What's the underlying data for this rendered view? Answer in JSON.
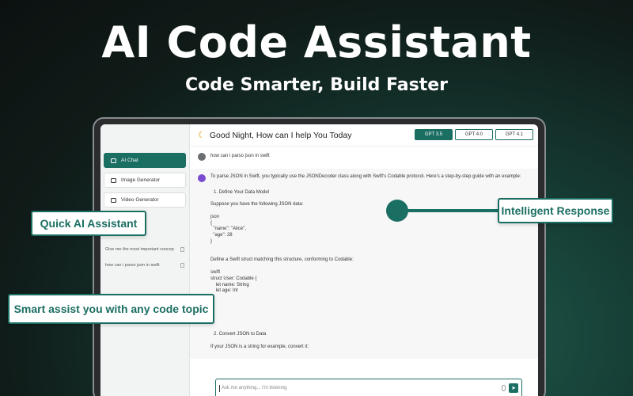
{
  "hero": {
    "title": "AI Code Assistant",
    "subtitle": "Code Smarter, Build Faster"
  },
  "sidebar": {
    "items": [
      {
        "label": "AI Chat",
        "icon": "chat-icon",
        "active": true
      },
      {
        "label": "Image Generator",
        "icon": "image-icon",
        "active": false
      },
      {
        "label": "Video Generator",
        "icon": "video-icon",
        "active": false
      }
    ],
    "history": [
      {
        "label": "Give me the most important concep"
      },
      {
        "label": "how can i parso json in swift"
      }
    ]
  },
  "header": {
    "greeting": "Good Night, How can I help You Today",
    "models": [
      {
        "label": "GPT 3.5",
        "active": true
      },
      {
        "label": "GPT 4.0",
        "active": false
      },
      {
        "label": "GPT 4.1",
        "active": false
      }
    ]
  },
  "chat": {
    "user_message": "how can i parso json in swift",
    "answer_lines": [
      "To parse JSON in Swift, you typically use the JSONDecoder class along with Swift's Codable protocol. Here's a step-by-step guide with an example:",
      "",
      "1. Define Your Data Model",
      "",
      "Suppose you have the following JSON data:",
      "",
      "json",
      "{",
      "  \"name\": \"Alice\",",
      "  \"age\": 28",
      "}",
      "",
      "",
      "Define a Swift struct matching this structure, conforming to Codable:",
      "",
      "swift",
      "struct User: Codable {",
      "    let name: String",
      "    let age: Int",
      "",
      "",
      "",
      "",
      "",
      "",
      "2. Convert JSON to Data",
      "",
      "If your JSON is a string for example, convert it:"
    ]
  },
  "input": {
    "placeholder": "Ask me anything... I'm listening"
  },
  "callouts": {
    "quick": "Quick AI Assistant",
    "smart": "Smart assist you with any code topic",
    "intelligent": "Intelligent Response"
  },
  "colors": {
    "accent": "#1b6e62",
    "background": "#101c19"
  }
}
